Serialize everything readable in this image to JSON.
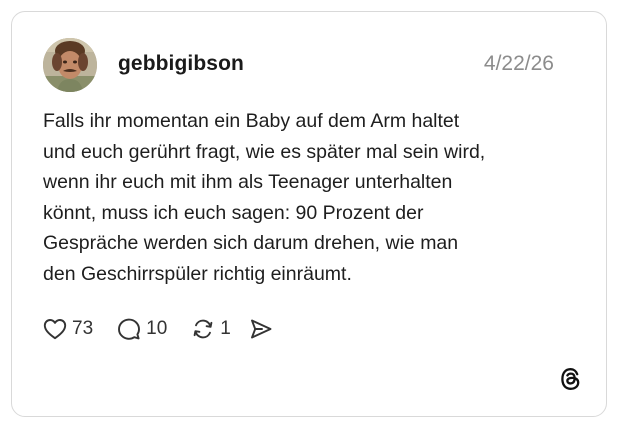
{
  "post": {
    "username": "gebbigibson",
    "date": "4/22/26",
    "text_lines": [
      "Falls ihr momentan ein Baby auf dem Arm haltet",
      "und euch gerührt fragt, wie es später mal sein wird,",
      "wenn ihr euch mit ihm als Teenager unterhalten",
      "könnt, muss ich euch sagen: 90 Prozent der",
      "Gespräche werden sich darum drehen, wie man",
      "den Geschirrspüler richtig einräumt."
    ],
    "actions": {
      "likes": "73",
      "replies": "10",
      "reposts": "1"
    }
  },
  "icons": {
    "like": "heart-icon",
    "reply": "speech-bubble-icon",
    "repost": "repost-icon",
    "share": "send-icon",
    "brand": "threads-logo-icon"
  },
  "colors": {
    "text": "#1a1a1a",
    "muted": "#8c8c8c",
    "border": "#d9d9d9"
  }
}
